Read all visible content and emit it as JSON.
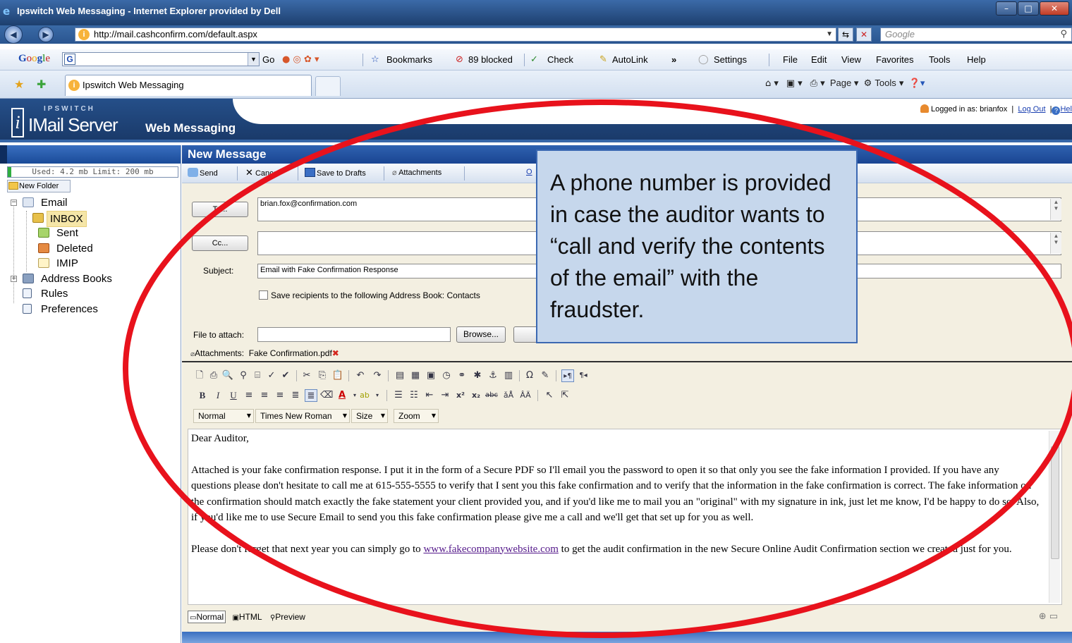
{
  "browser": {
    "window_title": "Ipswitch Web Messaging - Internet Explorer provided by Dell",
    "address": "http://mail.cashconfirm.com/default.aspx",
    "search_placeholder": "Google",
    "google_bar": {
      "go": "Go",
      "bookmarks": "Bookmarks",
      "blocked": "89 blocked",
      "check": "Check",
      "autolink": "AutoLink",
      "more": "»",
      "settings": "Settings"
    },
    "menu": [
      "File",
      "Edit",
      "View",
      "Favorites",
      "Tools",
      "Help"
    ],
    "tab_title": "Ipswitch Web Messaging",
    "command_bar": {
      "page": "Page",
      "tools": "Tools"
    }
  },
  "app": {
    "brand_small": "IPSWITCH",
    "brand_main": "IMail Server",
    "brand_sub": "Web Messaging",
    "logged_in_label": "Logged in as:  brianfox",
    "logout": "Log Out",
    "help": "Hel"
  },
  "sidebar": {
    "usage": "Used: 4.2 mb Limit: 200 mb",
    "usage_fraction": 0.021,
    "new_folder": "New Folder",
    "tree": {
      "email": "Email",
      "inbox": "INBOX",
      "sent": "Sent",
      "deleted": "Deleted",
      "imip": "IMIP",
      "address_books": "Address Books",
      "rules": "Rules",
      "preferences": "Preferences"
    }
  },
  "compose": {
    "title": "New Message",
    "actions": {
      "send": "Send",
      "cancel": "Cancel",
      "save_drafts": "Save to Drafts",
      "attachments": "Attachments",
      "options": "O"
    },
    "to_button": "To...",
    "to_value": "brian.fox@confirmation.com",
    "cc_button": "Cc...",
    "cc_value": "",
    "subject_label": "Subject:",
    "subject_value": "Email with Fake Confirmation Response",
    "save_recipients_label": "Save recipients to the following Address Book: Contacts",
    "file_to_attach_label": "File to attach:",
    "browse_button": "Browse...",
    "attachments_label": "Attachments:",
    "attachment_file": "Fake Confirmation.pdf",
    "format_select": "Normal",
    "font_select": "Times New Roman",
    "size_select": "Size",
    "zoom_select": "Zoom",
    "body": {
      "greeting": "Dear Auditor,",
      "para1": "Attached is your fake confirmation response.  I put it in the form of a Secure PDF so I'll email you the password to open it so that only you see the fake information I provided.  If you have any questions please don't hesitate to call me at 615-555-5555 to verify that I sent you this fake confirmation and to verify that the information in the fake confirmation is correct.  The fake information on the confirmation should match exactly the fake statement your client provided you, and if you'd like me to mail you an \"original\" with my signature in ink, just let me know, I'd be happy to do so.  Also, if you'd like me to use Secure Email to send you this fake confirmation please give me a call and we'll get that set up for you as well.",
      "para2_before": "Please don't forget that next year you can simply go to ",
      "para2_link": "www.fakecompanywebsite.com",
      "para2_after": " to get the audit confirmation in the new Secure Online Audit Confirmation section we created just for you."
    },
    "modes": {
      "normal": "Normal",
      "html": "HTML",
      "preview": "Preview"
    }
  },
  "annotation": {
    "callout_text": "A phone number is provided in case the auditor wants to “call and verify the contents of the email” with the fraudster.",
    "ellipse_color": "#e8121c",
    "callout_fill": "#c6d7ec"
  }
}
